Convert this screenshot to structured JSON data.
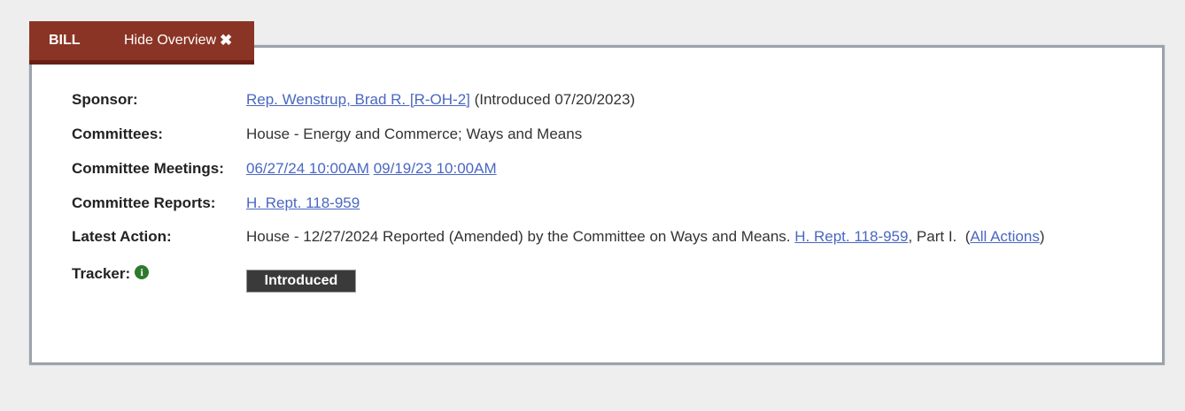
{
  "tab": {
    "title": "BILL",
    "toggle_label": "Hide Overview",
    "close_glyph": "✖"
  },
  "overview": {
    "sponsor": {
      "label": "Sponsor:",
      "link": "Rep. Wenstrup, Brad R. [R-OH-2]",
      "introduced": " (Introduced 07/20/2023)"
    },
    "committees": {
      "label": "Committees:",
      "value": "House - Energy and Commerce; Ways and Means"
    },
    "meetings": {
      "label": "Committee Meetings:",
      "items": [
        "06/27/24 10:00AM",
        "09/19/23 10:00AM"
      ]
    },
    "reports": {
      "label": "Committee Reports:",
      "link": "H. Rept. 118-959"
    },
    "latest_action": {
      "label": "Latest Action:",
      "text": "House - 12/27/2024 Reported (Amended) by the Committee on Ways and Means. ",
      "report_link": "H. Rept. 118-959",
      "suffix": ", Part I.  (",
      "all_actions_link": "All Actions",
      "close_paren": ")"
    },
    "tracker": {
      "label": "Tracker:",
      "info_icon": "i",
      "status": "Introduced"
    }
  },
  "colors": {
    "tab_bg": "#8a3425",
    "link": "#4a67c2",
    "tracker_bg": "#3a3a3a",
    "info_icon": "#2d7a2d"
  }
}
